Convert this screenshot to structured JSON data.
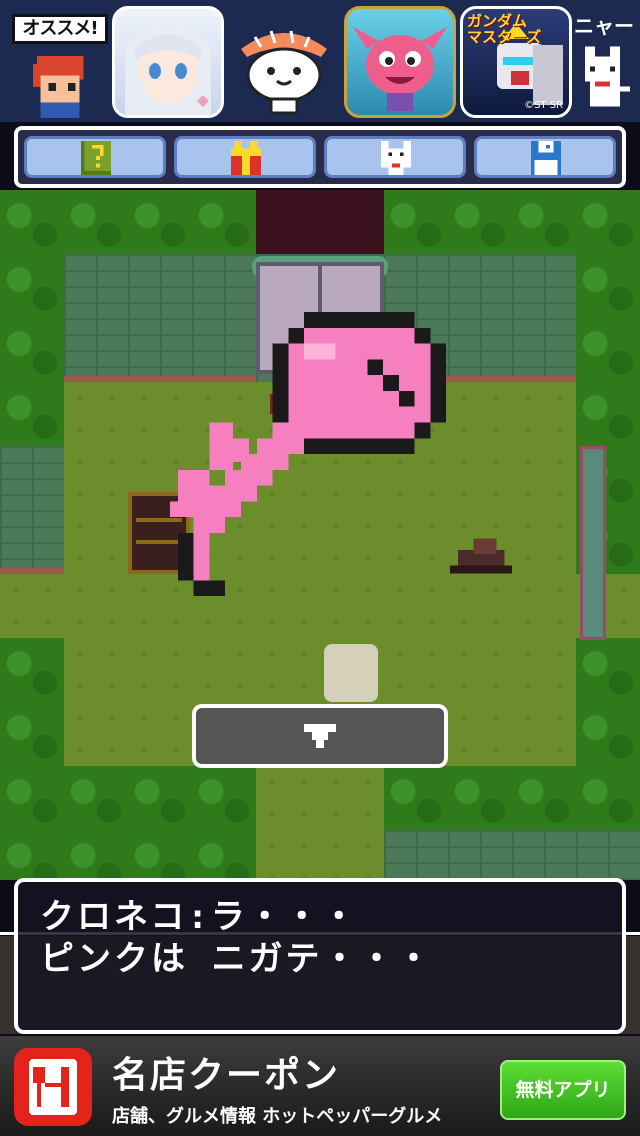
{
  "promo": {
    "osusume_label": "オススメ!",
    "more_label": "ニャー",
    "apps": [
      {
        "name": "anime-girl-app",
        "label": ""
      },
      {
        "name": "sushi-cat-app",
        "label": ""
      },
      {
        "name": "pink-monster-app",
        "label": ""
      },
      {
        "name": "gundam-app",
        "label": "ガンダム\nマスターズ",
        "credit": "©ST·SR"
      }
    ]
  },
  "toolbar": {
    "buttons": [
      {
        "icon": "hint-book-icon"
      },
      {
        "icon": "gift-icon"
      },
      {
        "icon": "cat-icon"
      },
      {
        "icon": "save-disk-icon"
      }
    ]
  },
  "dialogue": {
    "line1": "クロネコ:ラ・・・",
    "line2": "ピンクは ニガテ・・・"
  },
  "ad": {
    "title": "名店クーポン",
    "subtitle": "店舗、グルメ情報 ホットペッパーグルメ",
    "cta": "無料アプリ"
  },
  "colors": {
    "key_pink": "#f57fbf",
    "forest": "#2f7b1c",
    "floor": "#6b8d2c",
    "cta_green": "#3cc21e"
  }
}
